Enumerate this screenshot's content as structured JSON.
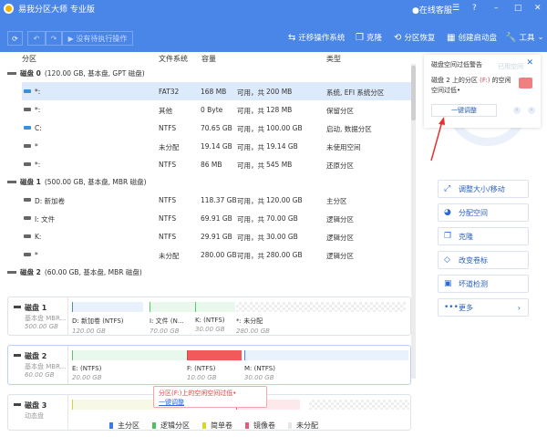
{
  "app": {
    "title": "易我分区大师 专业版",
    "online_service": "在线客服"
  },
  "toolbar": {
    "pending": "没有待执行操作",
    "tools": [
      "迁移操作系统",
      "克隆",
      "分区恢复",
      "创建启动盘",
      "工具"
    ]
  },
  "columns": [
    "分区",
    "文件系统",
    "容量",
    "类型"
  ],
  "disks": [
    {
      "name": "磁盘 0",
      "info": "(120.00 GB, 基本盘, GPT 磁盘)",
      "parts": [
        {
          "name": "*:",
          "fs": "FAT32",
          "free": "168 MB",
          "sep": "可用，共",
          "total": "200 MB",
          "type": "系统, EFI 系统分区",
          "selected": true
        },
        {
          "name": "*:",
          "fs": "其他",
          "free": "0 Byte",
          "sep": "可用，共",
          "total": "128 MB",
          "type": "保留分区"
        },
        {
          "name": "C:",
          "fs": "NTFS",
          "free": "70.65 GB",
          "sep": "可用，共",
          "total": "100.00 GB",
          "type": "启动, 数据分区"
        },
        {
          "name": "*",
          "fs": "未分配",
          "free": "19.14 GB",
          "sep": "可用，共",
          "total": "19.14 GB",
          "type": "未使用空间"
        },
        {
          "name": "*:",
          "fs": "NTFS",
          "free": "86 MB",
          "sep": "可用，共",
          "total": "545 MB",
          "type": "还原分区"
        }
      ]
    },
    {
      "name": "磁盘 1",
      "info": "(500.00 GB, 基本盘, MBR 磁盘)",
      "parts": [
        {
          "name": "D: 新加卷",
          "fs": "NTFS",
          "free": "118.37 GB",
          "sep": "可用，共",
          "total": "120.00 GB",
          "type": "主分区"
        },
        {
          "name": "I: 文件",
          "fs": "NTFS",
          "free": "69.91 GB",
          "sep": "可用，共",
          "total": "70.00 GB",
          "type": "逻辑分区"
        },
        {
          "name": "K:",
          "fs": "NTFS",
          "free": "29.91 GB",
          "sep": "可用，共",
          "total": "30.00 GB",
          "type": "逻辑分区"
        },
        {
          "name": "*",
          "fs": "未分配",
          "free": "280.00 GB",
          "sep": "可用，共",
          "total": "280.00 GB",
          "type": "逻辑分区"
        }
      ]
    },
    {
      "name": "磁盘 2",
      "info": "(60.00 GB, 基本盘, MBR 磁盘)",
      "parts": []
    }
  ],
  "maps": [
    {
      "name": "磁盘 1",
      "type": "基本盘 MBR...",
      "size": "500.00 GB",
      "segs": [
        {
          "label": "D: 新加卷 (NTFS)",
          "size": "120.00 GB",
          "color": "#4a86e8",
          "bg": "#e8f1fc"
        },
        {
          "label": "I: 文件 (N...",
          "size": "70.00 GB",
          "color": "#5cc46d",
          "bg": "#e9f8ec"
        },
        {
          "label": "K: (NTFS)",
          "size": "30.00 GB",
          "color": "#5cc46d",
          "bg": "#e9f8ec"
        },
        {
          "label": "*: 未分配",
          "size": "280.00 GB",
          "color": "",
          "bg": ""
        }
      ]
    },
    {
      "name": "磁盘 2",
      "type": "基本盘 MBR...",
      "size": "60.00 GB",
      "segs": [
        {
          "label": "E: (NTFS)",
          "size": "20.00 GB",
          "color": "#5cc46d",
          "bg": "#e9f8ec"
        },
        {
          "label": "F: (NTFS)",
          "size": "10.00 GB",
          "color": "#f04040",
          "bg": "#f25a5a"
        },
        {
          "label": "M: (NTFS)",
          "size": "30.00 GB",
          "color": "#4a86e8",
          "bg": "#e8f1fc"
        }
      ]
    },
    {
      "name": "磁盘 3",
      "type": "动态盘",
      "size": "",
      "segs": []
    }
  ],
  "tooltip": {
    "text": "分区(F:)上的空闲空间过低•",
    "link": "一键调整"
  },
  "legend": [
    {
      "label": "主分区",
      "color": "#3b7be8"
    },
    {
      "label": "逻辑分区",
      "color": "#4cc160"
    },
    {
      "label": "简单卷",
      "color": "#d4d82a"
    },
    {
      "label": "镜像卷",
      "color": "#e85a7a"
    },
    {
      "label": "未分配",
      "color": "#e6e6e6"
    }
  ],
  "warning": {
    "title": "磁盘空间过低警告",
    "text_a": "磁盘 2 上的分区 ",
    "text_hl": "(F:)",
    "text_b": " 的空闲空间过低•",
    "button": "一键调整",
    "ring_label": "已用空间"
  },
  "actions": [
    {
      "label": "调整大小/移动",
      "icon": "resize-icon"
    },
    {
      "label": "分配空间",
      "icon": "pie-icon"
    },
    {
      "label": "克隆",
      "icon": "clone-icon"
    },
    {
      "label": "改变卷标",
      "icon": "tag-icon"
    },
    {
      "label": "坏道检测",
      "icon": "scan-icon"
    },
    {
      "label": "更多",
      "icon": "more-icon"
    }
  ]
}
